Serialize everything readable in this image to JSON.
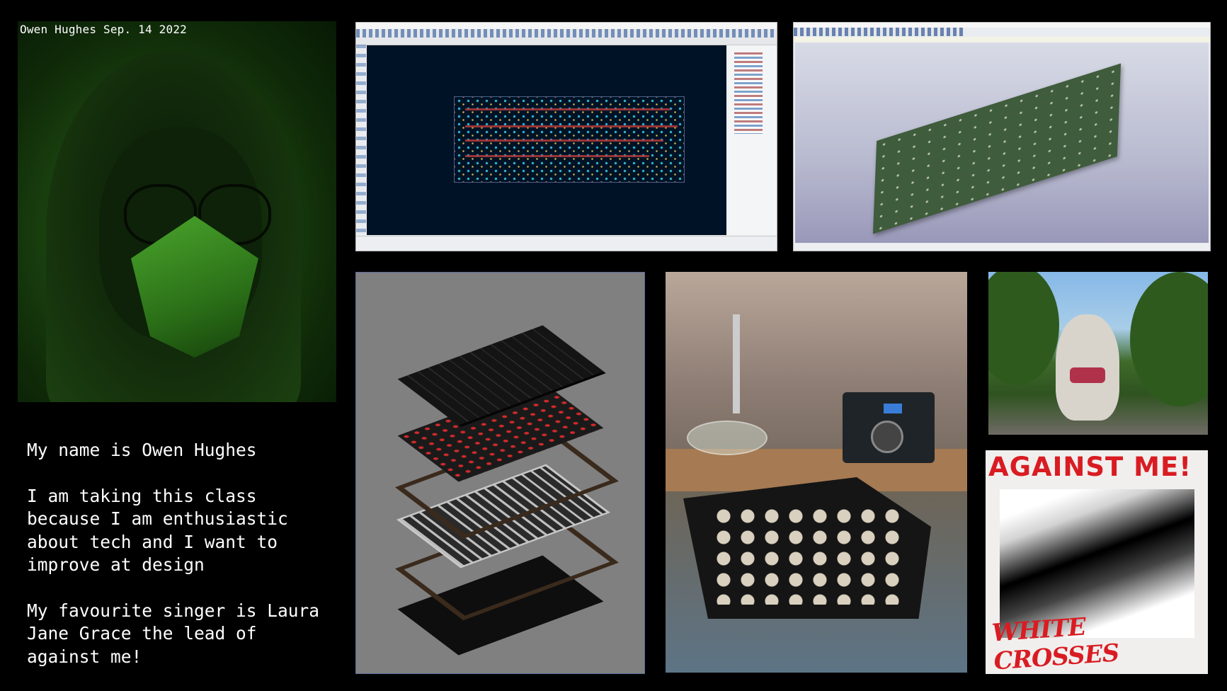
{
  "webcam": {
    "caption": "Owen Hughes Sep. 14 2022"
  },
  "intro": {
    "line1": "My name is Owen Hughes",
    "line2": "I am taking this class because I am enthusiastic about tech and I want to improve at design",
    "line3": "My favourite singer is Laura Jane Grace the lead of against me!"
  },
  "album": {
    "title": "AGAINST ME!",
    "subtitle": "WHITE CROSSES"
  },
  "colors": {
    "background": "#000000",
    "album_red": "#d91c22",
    "pcb_canvas": "#001226"
  }
}
